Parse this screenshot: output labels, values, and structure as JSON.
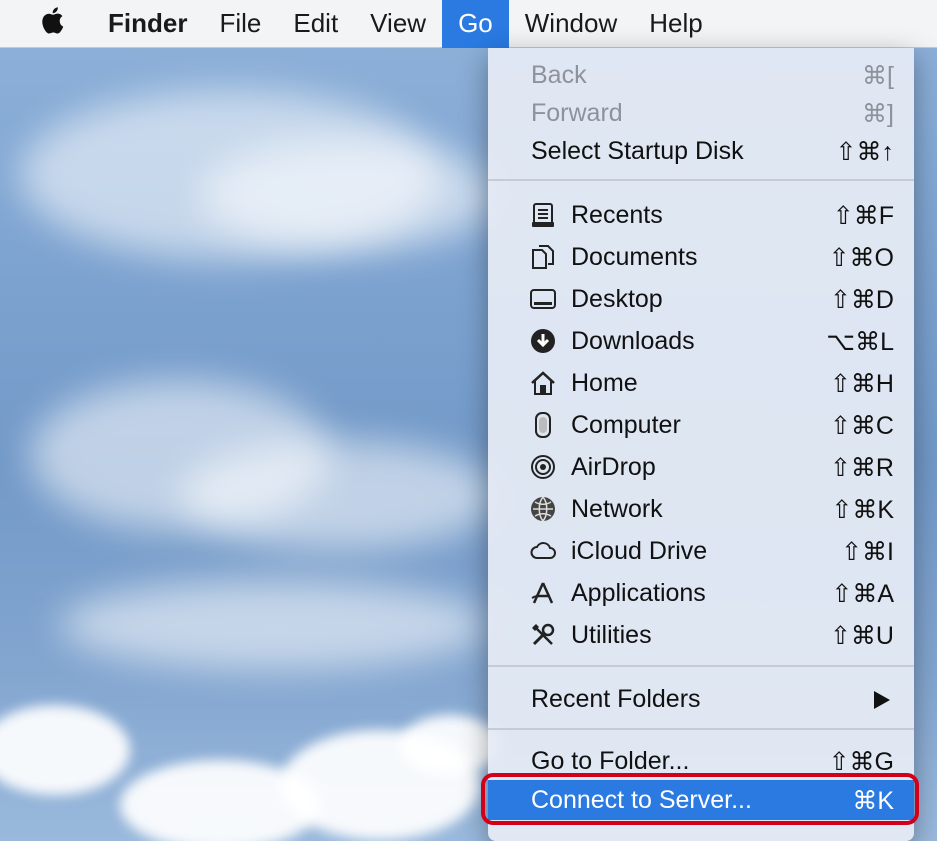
{
  "menubar": {
    "apple_icon": "apple-logo-icon",
    "items": [
      "Finder",
      "File",
      "Edit",
      "View",
      "Go",
      "Window",
      "Help"
    ],
    "active": "Go"
  },
  "go_menu": {
    "nav": [
      {
        "label": "Back",
        "shortcut": "⌘[",
        "enabled": false
      },
      {
        "label": "Forward",
        "shortcut": "⌘]",
        "enabled": false
      },
      {
        "label": "Select Startup Disk",
        "shortcut": "⇧⌘↑",
        "enabled": true
      }
    ],
    "places": [
      {
        "label": "Recents",
        "shortcut": "⇧⌘F",
        "icon": "recents-icon"
      },
      {
        "label": "Documents",
        "shortcut": "⇧⌘O",
        "icon": "documents-icon"
      },
      {
        "label": "Desktop",
        "shortcut": "⇧⌘D",
        "icon": "desktop-icon"
      },
      {
        "label": "Downloads",
        "shortcut": "⌥⌘L",
        "icon": "downloads-icon"
      },
      {
        "label": "Home",
        "shortcut": "⇧⌘H",
        "icon": "home-icon"
      },
      {
        "label": "Computer",
        "shortcut": "⇧⌘C",
        "icon": "computer-icon"
      },
      {
        "label": "AirDrop",
        "shortcut": "⇧⌘R",
        "icon": "airdrop-icon"
      },
      {
        "label": "Network",
        "shortcut": "⇧⌘K",
        "icon": "network-icon"
      },
      {
        "label": "iCloud Drive",
        "shortcut": "⇧⌘I",
        "icon": "icloud-icon"
      },
      {
        "label": "Applications",
        "shortcut": "⇧⌘A",
        "icon": "applications-icon"
      },
      {
        "label": "Utilities",
        "shortcut": "⇧⌘U",
        "icon": "utilities-icon"
      }
    ],
    "recent_folders": {
      "label": "Recent Folders",
      "icon": "submenu-arrow-icon"
    },
    "go_to_folder": {
      "label": "Go to Folder...",
      "shortcut": "⇧⌘G"
    },
    "connect_to_server": {
      "label": "Connect to Server...",
      "shortcut": "⌘K",
      "highlighted": true
    }
  },
  "colors": {
    "highlight": "#2a7ae2",
    "annotation_border": "#d0021b"
  }
}
